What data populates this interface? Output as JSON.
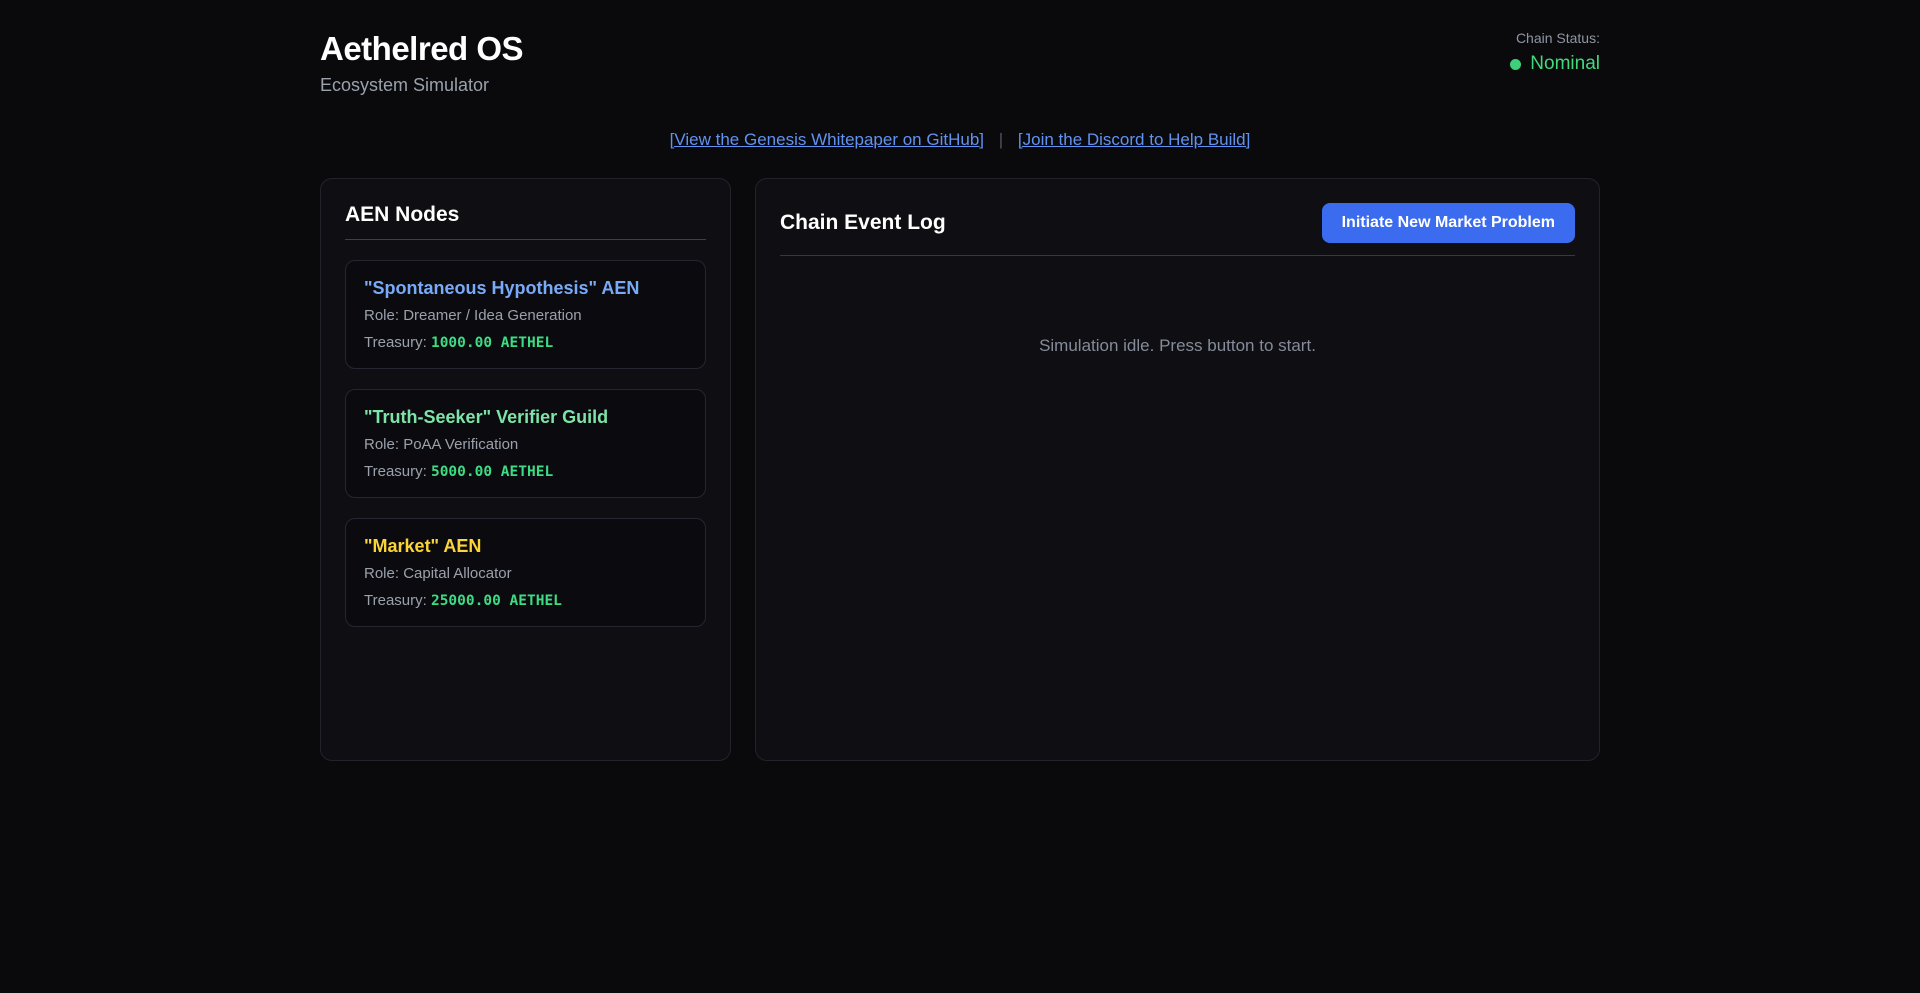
{
  "header": {
    "title": "Aethelred OS",
    "subtitle": "Ecosystem Simulator",
    "chain_status_label": "Chain Status:",
    "chain_status_value": "Nominal"
  },
  "links": {
    "whitepaper": "[View the Genesis Whitepaper on GitHub]",
    "separator": "|",
    "discord": "[Join the Discord to Help Build]"
  },
  "nodes_panel": {
    "title": "AEN Nodes",
    "nodes": [
      {
        "name": "\"Spontaneous Hypothesis\" AEN",
        "role_label": "Role:",
        "role_value": "Dreamer / Idea Generation",
        "treasury_label": "Treasury:",
        "treasury_value": "1000.00 AETHEL",
        "accent": "#79aaf8"
      },
      {
        "name": "\"Truth-Seeker\" Verifier Guild",
        "role_label": "Role:",
        "role_value": "PoAA Verification",
        "treasury_label": "Treasury:",
        "treasury_value": "5000.00 AETHEL",
        "accent": "#7de3a8"
      },
      {
        "name": "\"Market\" AEN",
        "role_label": "Role:",
        "role_value": "Capital Allocator",
        "treasury_label": "Treasury:",
        "treasury_value": "25000.00 AETHEL",
        "accent": "#fbd437"
      }
    ]
  },
  "log_panel": {
    "title": "Chain Event Log",
    "button_label": "Initiate New Market Problem",
    "idle_message": "Simulation idle. Press button to start."
  },
  "colors": {
    "page_background": "#0a0a0d",
    "panel_background": "#0e0e13",
    "panel_border": "#23232c",
    "status_green": "#44d87e",
    "treasury_green": "#3ddc84",
    "link_blue": "#6292f0",
    "button_blue": "#3b6cf0"
  }
}
